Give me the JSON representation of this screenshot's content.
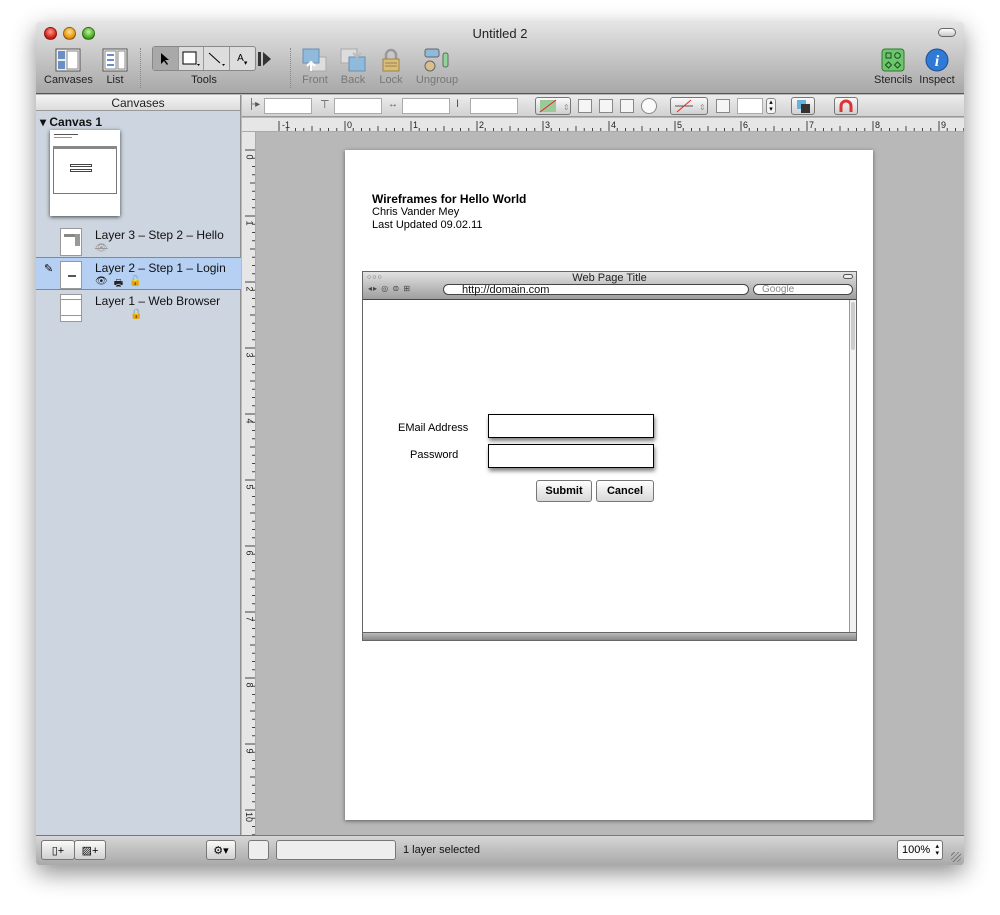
{
  "window": {
    "title": "Untitled 2"
  },
  "toolbar": {
    "canvases": "Canvases",
    "list": "List",
    "tools": "Tools",
    "front": "Front",
    "back": "Back",
    "lock": "Lock",
    "ungroup": "Ungroup",
    "stencils": "Stencils",
    "inspect": "Inspect",
    "text_tool": "A"
  },
  "sidebar": {
    "header": "Canvases",
    "canvas_name": "Canvas 1",
    "layers": [
      {
        "name": "Layer 3 – Step 2 – Hello",
        "selected": false
      },
      {
        "name": "Layer 2 – Step 1 – Login",
        "selected": true
      },
      {
        "name": "Layer 1 – Web Browser",
        "selected": false
      }
    ]
  },
  "rulers": {
    "horizontal": [
      "-1",
      "0",
      "1",
      "2",
      "3",
      "4",
      "5",
      "6",
      "7",
      "8",
      "9"
    ],
    "vertical": [
      "0",
      "1",
      "2",
      "3",
      "4",
      "5",
      "6",
      "7",
      "8",
      "9",
      "10"
    ]
  },
  "document": {
    "title": "Wireframes for Hello World",
    "author": "Chris Vander Mey",
    "updated": "Last Updated 09.02.11",
    "browser": {
      "title": "Web Page Title",
      "url": "http://domain.com",
      "search_placeholder": "Google"
    },
    "form": {
      "email_label": "EMail Address",
      "password_label": "Password",
      "submit": "Submit",
      "cancel": "Cancel"
    }
  },
  "statusbar": {
    "status": "1 layer selected",
    "zoom": "100%"
  }
}
